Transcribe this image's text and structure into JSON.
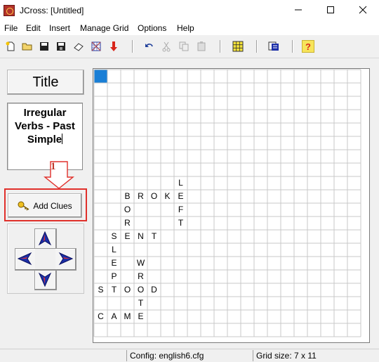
{
  "window": {
    "title": "JCross: [Untitled]",
    "minimize": "—",
    "maximize": "☐",
    "close": "✕"
  },
  "menu": [
    "File",
    "Edit",
    "Insert",
    "Manage Grid",
    "Options",
    "Help"
  ],
  "toolbar": {
    "icons": [
      "new-icon",
      "open-icon",
      "save-icon",
      "save-as-icon",
      "eraser-icon",
      "web-page-icon",
      "down-arrow-icon",
      "undo-icon",
      "cut-icon",
      "copy-icon",
      "paste-icon",
      "grid-icon",
      "export-icon",
      "help-icon"
    ],
    "help_glyph": "?"
  },
  "left_panel": {
    "title_button": "Title",
    "puzzle_title_lines": [
      "Irregular",
      "Verbs - Past",
      "Simple"
    ],
    "callout_number": "1",
    "add_clues_label": "Add Clues"
  },
  "grid": {
    "columns": 20,
    "rows": 20,
    "highlight_cell": {
      "col": 0,
      "row": 0,
      "color": "#1a7fd6"
    },
    "letters": [
      {
        "c": 6,
        "r": 8,
        "t": "L"
      },
      {
        "c": 2,
        "r": 9,
        "t": "B"
      },
      {
        "c": 3,
        "r": 9,
        "t": "R"
      },
      {
        "c": 4,
        "r": 9,
        "t": "O"
      },
      {
        "c": 5,
        "r": 9,
        "t": "K"
      },
      {
        "c": 6,
        "r": 9,
        "t": "E"
      },
      {
        "c": 2,
        "r": 10,
        "t": "O"
      },
      {
        "c": 6,
        "r": 10,
        "t": "F"
      },
      {
        "c": 2,
        "r": 11,
        "t": "R"
      },
      {
        "c": 6,
        "r": 11,
        "t": "T"
      },
      {
        "c": 1,
        "r": 12,
        "t": "S"
      },
      {
        "c": 2,
        "r": 12,
        "t": "E"
      },
      {
        "c": 3,
        "r": 12,
        "t": "N"
      },
      {
        "c": 4,
        "r": 12,
        "t": "T"
      },
      {
        "c": 1,
        "r": 13,
        "t": "L"
      },
      {
        "c": 1,
        "r": 14,
        "t": "E"
      },
      {
        "c": 3,
        "r": 14,
        "t": "W"
      },
      {
        "c": 1,
        "r": 15,
        "t": "P"
      },
      {
        "c": 3,
        "r": 15,
        "t": "R"
      },
      {
        "c": 0,
        "r": 16,
        "t": "S"
      },
      {
        "c": 1,
        "r": 16,
        "t": "T"
      },
      {
        "c": 2,
        "r": 16,
        "t": "O"
      },
      {
        "c": 3,
        "r": 16,
        "t": "O"
      },
      {
        "c": 4,
        "r": 16,
        "t": "D"
      },
      {
        "c": 3,
        "r": 17,
        "t": "T"
      },
      {
        "c": 0,
        "r": 18,
        "t": "C"
      },
      {
        "c": 1,
        "r": 18,
        "t": "A"
      },
      {
        "c": 2,
        "r": 18,
        "t": "M"
      },
      {
        "c": 3,
        "r": 18,
        "t": "E"
      }
    ]
  },
  "status": {
    "config": "Config: english6.cfg",
    "grid_size": "Grid size: 7 x 11"
  },
  "colors": {
    "accent": "#1a7fd6",
    "callout": "#e0302b",
    "nav_arrow": "#1c2fa8"
  }
}
